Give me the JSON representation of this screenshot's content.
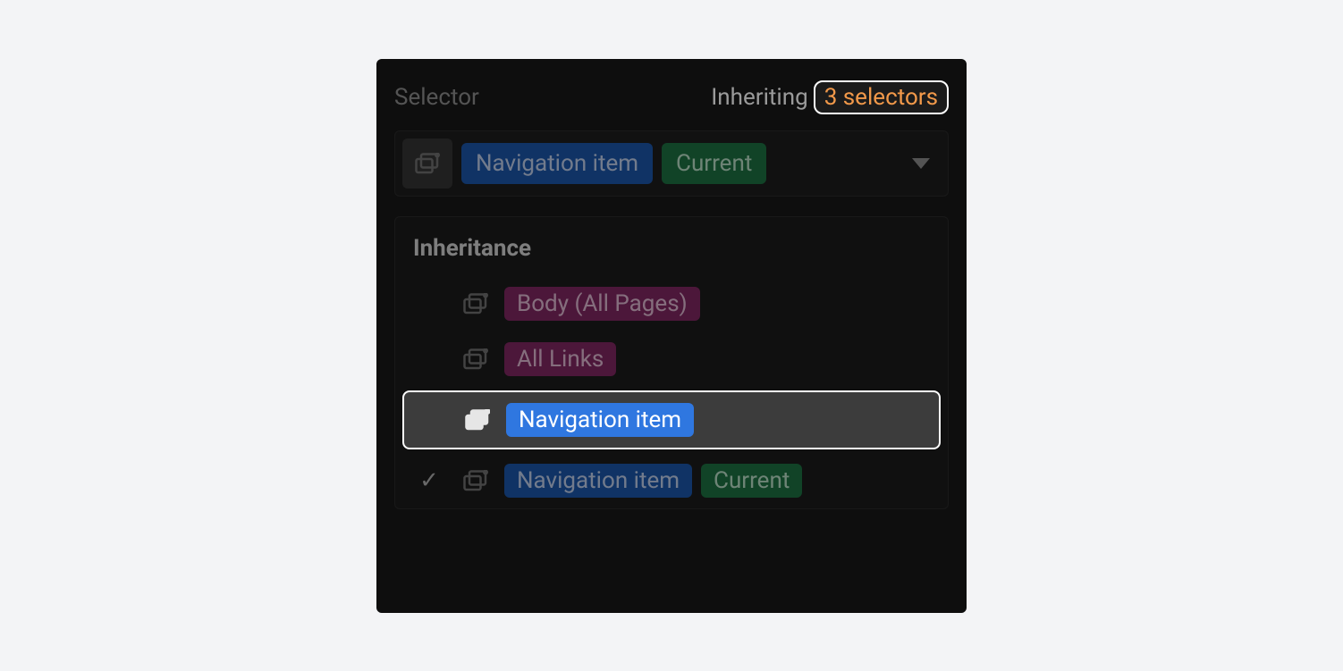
{
  "header": {
    "selector_label": "Selector",
    "inheriting_label": "Inheriting",
    "selectors_count_label": "3 selectors"
  },
  "selector_bar": {
    "class_tag": "Navigation item",
    "state_tag": "Current"
  },
  "inheritance": {
    "title": "Inheritance",
    "rows": [
      {
        "checked": false,
        "tags": [
          {
            "text": "Body (All Pages)",
            "color": "pink"
          }
        ],
        "highlighted": false
      },
      {
        "checked": false,
        "tags": [
          {
            "text": "All Links",
            "color": "pink"
          }
        ],
        "highlighted": false
      },
      {
        "checked": false,
        "tags": [
          {
            "text": "Navigation item",
            "color": "blue"
          }
        ],
        "highlighted": true
      },
      {
        "checked": true,
        "tags": [
          {
            "text": "Navigation item",
            "color": "blue"
          },
          {
            "text": "Current",
            "color": "green"
          }
        ],
        "highlighted": false
      }
    ]
  }
}
